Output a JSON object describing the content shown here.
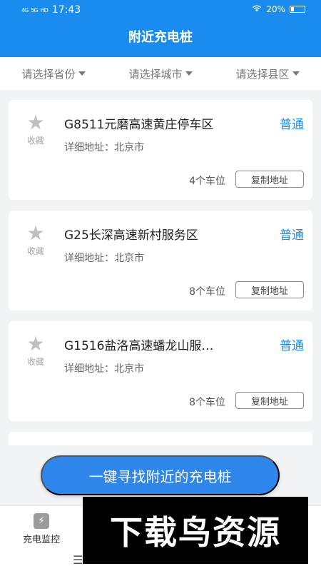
{
  "status_bar": {
    "signal_1": "4G",
    "signal_2": "5G",
    "hd": "HD",
    "time": "17:43",
    "battery": "20%"
  },
  "header": {
    "title": "附近充电桩"
  },
  "filters": [
    {
      "label": "请选择省份"
    },
    {
      "label": "请选择城市"
    },
    {
      "label": "请选择县区"
    }
  ],
  "stations": [
    {
      "fav_label": "收藏",
      "name": "G8511元磨高速黄庄停车区",
      "tag": "普通",
      "address": "详细地址：北京市",
      "slots": "4个车位",
      "copy": "复制地址"
    },
    {
      "fav_label": "收藏",
      "name": "G25长深高速新村服务区",
      "tag": "普通",
      "address": "详细地址：北京市",
      "slots": "8个车位",
      "copy": "复制地址"
    },
    {
      "fav_label": "收藏",
      "name": "G1516盐洛高速蟠龙山服…",
      "tag": "普通",
      "address": "详细地址：北京市",
      "slots": "8个车位",
      "copy": "复制地址"
    }
  ],
  "find_button": "一键寻找附近的充电桩",
  "tabbar": {
    "tab_label": "充电监控",
    "tab_icon": "charging-monitor-icon",
    "menu_icon": "menu-icon"
  },
  "watermark": "下载鸟资源",
  "colors": {
    "primary": "#1a8cf0",
    "button": "#2f86ea",
    "tag": "#1a8cf0"
  }
}
